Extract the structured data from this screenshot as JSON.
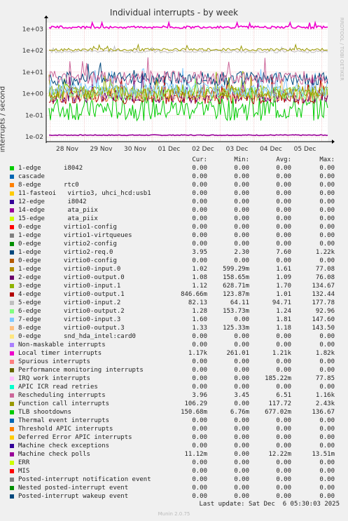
{
  "chart_data": {
    "type": "line",
    "title": "Individual interrupts - by week",
    "ylabel": "interrupts / second",
    "side_label": "RRDTOOL / TOBI OETIKER",
    "y_scale": "log",
    "ylim": [
      0.006,
      2000
    ],
    "y_ticks": [
      "1e-02",
      "1e-01",
      "1e+00",
      "1e+01",
      "1e+02",
      "1e+03"
    ],
    "x_ticks": [
      "28 Nov",
      "29 Nov",
      "30 Nov",
      "01 Dec",
      "02 Dec",
      "03 Dec",
      "04 Dec",
      "05 Dec"
    ],
    "grid": true,
    "columns": [
      "Cur:",
      "Min:",
      "Avg:",
      "Max:"
    ],
    "series": [
      {
        "name": "1-edge      i8042",
        "color": "#00cc00",
        "cur": "0.00",
        "min": "0.00",
        "avg": "0.00",
        "max": "0.00",
        "level": 0
      },
      {
        "name": "cascade",
        "color": "#0066b3",
        "cur": "0.00",
        "min": "0.00",
        "avg": "0.00",
        "max": "0.00",
        "level": 0
      },
      {
        "name": "8-edge      rtc0",
        "color": "#ff8000",
        "cur": "0.00",
        "min": "0.00",
        "avg": "0.00",
        "max": "0.00",
        "level": 0
      },
      {
        "name": "11-fasteoi   virtio3, uhci_hcd:usb1",
        "color": "#ffcc00",
        "cur": "0.00",
        "min": "0.00",
        "avg": "0.00",
        "max": "0.00",
        "level": 0
      },
      {
        "name": "12-edge      i8042",
        "color": "#330099",
        "cur": "0.00",
        "min": "0.00",
        "avg": "0.00",
        "max": "0.00",
        "level": 0
      },
      {
        "name": "14-edge      ata_piix",
        "color": "#990099",
        "cur": "0.00",
        "min": "0.00",
        "avg": "0.00",
        "max": "0.00",
        "level": 0
      },
      {
        "name": "15-edge      ata_piix",
        "color": "#ccff00",
        "cur": "0.00",
        "min": "0.00",
        "avg": "0.00",
        "max": "0.00",
        "level": 0
      },
      {
        "name": "0-edge      virtio1-config",
        "color": "#ff0000",
        "cur": "0.00",
        "min": "0.00",
        "avg": "0.00",
        "max": "0.00",
        "level": 0
      },
      {
        "name": "1-edge      virtio1-virtqueues",
        "color": "#808080",
        "cur": "0.00",
        "min": "0.00",
        "avg": "0.00",
        "max": "0.00",
        "level": 0
      },
      {
        "name": "0-edge      virtio2-config",
        "color": "#008f00",
        "cur": "0.00",
        "min": "0.00",
        "avg": "0.00",
        "max": "0.00",
        "level": 0
      },
      {
        "name": "1-edge      virtio2-req.0",
        "color": "#00487d",
        "cur": "3.95",
        "min": "2.30",
        "avg": "7.60",
        "max": "1.22k",
        "level": 5
      },
      {
        "name": "0-edge      virtio0-config",
        "color": "#b35a00",
        "cur": "0.00",
        "min": "0.00",
        "avg": "0.00",
        "max": "0.00",
        "level": 0
      },
      {
        "name": "1-edge      virtio0-input.0",
        "color": "#b38f00",
        "cur": "1.02",
        "min": "599.29m",
        "avg": "1.61",
        "max": "77.08",
        "level": 1.1
      },
      {
        "name": "2-edge      virtio0-output.0",
        "color": "#6b006b",
        "cur": "1.08",
        "min": "158.65m",
        "avg": "1.09",
        "max": "76.08",
        "level": 0.8
      },
      {
        "name": "3-edge      virtio0-input.1",
        "color": "#8fb300",
        "cur": "1.12",
        "min": "628.71m",
        "avg": "1.70",
        "max": "134.67",
        "level": 1.3
      },
      {
        "name": "4-edge      virtio0-output.1",
        "color": "#b30000",
        "cur": "846.66m",
        "min": "123.87m",
        "avg": "1.01",
        "max": "132.44",
        "level": 0.7
      },
      {
        "name": "5-edge      virtio0-input.2",
        "color": "#bebebe",
        "cur": "82.13",
        "min": "64.11",
        "avg": "94.71",
        "max": "177.78",
        "level": 90
      },
      {
        "name": "6-edge      virtio0-output.2",
        "color": "#80ff80",
        "cur": "1.28",
        "min": "153.73m",
        "avg": "1.24",
        "max": "92.96",
        "level": 1.0
      },
      {
        "name": "7-edge      virtio0-input.3",
        "color": "#80c9ff",
        "cur": "1.60",
        "min": "0.00",
        "avg": "1.81",
        "max": "147.60",
        "level": 1.5
      },
      {
        "name": "8-edge      virtio0-output.3",
        "color": "#ffc080",
        "cur": "1.33",
        "min": "125.33m",
        "avg": "1.18",
        "max": "143.50",
        "level": 0.9
      },
      {
        "name": "0-edge      snd_hda_intel:card0",
        "color": "#ffe680",
        "cur": "0.00",
        "min": "0.00",
        "avg": "0.00",
        "max": "0.00",
        "level": 0
      },
      {
        "name": "Non-maskable interrupts",
        "color": "#aa80ff",
        "cur": "0.00",
        "min": "0.00",
        "avg": "0.00",
        "max": "0.00",
        "level": 0
      },
      {
        "name": "Local timer interrupts",
        "color": "#ee00cc",
        "cur": "1.17k",
        "min": "261.01",
        "avg": "1.21k",
        "max": "1.82k",
        "level": 1200
      },
      {
        "name": "Spurious interrupts",
        "color": "#ff8080",
        "cur": "0.00",
        "min": "0.00",
        "avg": "0.00",
        "max": "0.00",
        "level": 0
      },
      {
        "name": "Performance monitoring interrupts",
        "color": "#666600",
        "cur": "0.00",
        "min": "0.00",
        "avg": "0.00",
        "max": "0.00",
        "level": 0
      },
      {
        "name": "IRQ work interrupts",
        "color": "#ffbfff",
        "cur": "0.00",
        "min": "0.00",
        "avg": "185.22m",
        "max": "77.85",
        "level": 0
      },
      {
        "name": "APIC ICR read retries",
        "color": "#00ffcc",
        "cur": "0.00",
        "min": "0.00",
        "avg": "0.00",
        "max": "0.00",
        "level": 0
      },
      {
        "name": "Rescheduling interrupts",
        "color": "#cc6699",
        "cur": "3.96",
        "min": "3.45",
        "avg": "6.51",
        "max": "1.16k",
        "level": 5.5
      },
      {
        "name": "Function call interrupts",
        "color": "#999900",
        "cur": "106.29",
        "min": "0.00",
        "avg": "117.72",
        "max": "2.43k",
        "level": 110
      },
      {
        "name": "TLB shootdowns",
        "color": "#00cc00",
        "cur": "150.68m",
        "min": "6.76m",
        "avg": "677.02m",
        "max": "136.67",
        "level": 0.2
      },
      {
        "name": "Thermal event interrupts",
        "color": "#0066b3",
        "cur": "0.00",
        "min": "0.00",
        "avg": "0.00",
        "max": "0.00",
        "level": 0
      },
      {
        "name": "Threshold APIC interrupts",
        "color": "#ff8000",
        "cur": "0.00",
        "min": "0.00",
        "avg": "0.00",
        "max": "0.00",
        "level": 0
      },
      {
        "name": "Deferred Error APIC interrupts",
        "color": "#ffcc00",
        "cur": "0.00",
        "min": "0.00",
        "avg": "0.00",
        "max": "0.00",
        "level": 0
      },
      {
        "name": "Machine check exceptions",
        "color": "#330099",
        "cur": "0.00",
        "min": "0.00",
        "avg": "0.00",
        "max": "0.00",
        "level": 0
      },
      {
        "name": "Machine check polls",
        "color": "#990099",
        "cur": "11.12m",
        "min": "0.00",
        "avg": "12.22m",
        "max": "13.51m",
        "level": 0.012
      },
      {
        "name": "ERR",
        "color": "#ccff00",
        "cur": "0.00",
        "min": "0.00",
        "avg": "0.00",
        "max": "0.00",
        "level": 0
      },
      {
        "name": "MIS",
        "color": "#ff0000",
        "cur": "0.00",
        "min": "0.00",
        "avg": "0.00",
        "max": "0.00",
        "level": 0
      },
      {
        "name": "Posted-interrupt notification event",
        "color": "#808080",
        "cur": "0.00",
        "min": "0.00",
        "avg": "0.00",
        "max": "0.00",
        "level": 0
      },
      {
        "name": "Nested posted-interrupt event",
        "color": "#008f00",
        "cur": "0.00",
        "min": "0.00",
        "avg": "0.00",
        "max": "0.00",
        "level": 0
      },
      {
        "name": "Posted-interrupt wakeup event",
        "color": "#00487d",
        "cur": "0.00",
        "min": "0.00",
        "avg": "0.00",
        "max": "0.00",
        "level": 0
      }
    ]
  },
  "footer": {
    "last_update": "Last update: Sat Dec  6 05:30:03 2025",
    "version": "Munin 2.0.75"
  }
}
